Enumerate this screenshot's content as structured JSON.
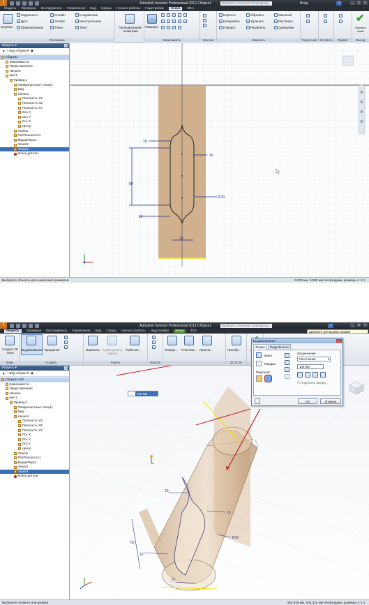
{
  "app": {
    "title": "Autodesk Inventor Professional 2012   Сборка1",
    "search_placeholder": "Введите ключевое слово/фразу",
    "login": "Вход",
    "help": "?",
    "tooltip": "Щелкните для вызова справки",
    "window_buttons": [
      "_",
      "□",
      "×"
    ]
  },
  "tabs": [
    "Модель",
    "Проверка",
    "Инструменты",
    "Управление",
    "Вид",
    "Среды",
    "Начало работы",
    "Надстройки",
    "Эскиз",
    "3DA"
  ],
  "active_tab": "Эскиз",
  "ribbon1": {
    "draw": {
      "otrezok": "Отрезок",
      "items": [
        "Окружность",
        "Дуга",
        "Прямоугольник",
        "Сплайн",
        "Эллипс",
        "Точка",
        "Сопряжение",
        "Многоугольник",
        "Текст"
      ],
      "label": "Рисование"
    },
    "project": "Проецирование геометрии",
    "dimension": "Размеры",
    "constraints_label": "Зависимость",
    "pattern_label": "Массив",
    "modify": {
      "items": [
        "Перенос",
        "Обрезать",
        "Масштаб",
        "Копировать",
        "Удлинить",
        "Растянуть",
        "Поворот",
        "Разделить",
        "Смещение"
      ],
      "label": "Изменить"
    },
    "insert_label": "Вставить",
    "format_label": "Формат",
    "layout_label": "Подсосная",
    "accept": "Принять эскиз",
    "exit_label": "Выход"
  },
  "ribbon2": {
    "sketch": "Создать 2D эскиз",
    "sketch_group": "Эскиз",
    "extrude": "Выдавливание",
    "revolve": "Вращение",
    "create_label": "Создать",
    "modify": "Изменить",
    "edit": "Редактировать модель",
    "work": "Рабочие...",
    "fusion_label": "Fusion",
    "surface": "Поверх...",
    "plastic": "Пластма...",
    "sheet": "Прокла...",
    "convert": "Преобр...",
    "to3d": "2D to 3D",
    "pattern_label": "Массив",
    "accept": "Принять эскиз"
  },
  "browser": {
    "title": "Модель",
    "view": "Вид сборки",
    "tree1": [
      {
        "label": "Сборка1",
        "level": 0,
        "state": "hl"
      },
      {
        "label": "Зависимости",
        "level": 1
      },
      {
        "label": "Представления",
        "level": 1
      },
      {
        "label": "Начало",
        "level": 1
      },
      {
        "label": "вал:1",
        "level": 1
      },
      {
        "label": "Привод:1",
        "level": 2
      },
      {
        "label": "Поверхностные тела(1)",
        "level": 3
      },
      {
        "label": "Вид:",
        "level": 3
      },
      {
        "label": "Начало",
        "level": 3
      },
      {
        "label": "Плоскость YZ",
        "level": 4
      },
      {
        "label": "Плоскость XZ",
        "level": 4
      },
      {
        "label": "Плоскость XY",
        "level": 4
      },
      {
        "label": "Ось X",
        "level": 4
      },
      {
        "label": "Ось Y",
        "level": 4
      },
      {
        "label": "Ось Z",
        "level": 4
      },
      {
        "label": "Центр",
        "level": 4
      },
      {
        "label": "Эскиз1",
        "level": 3
      },
      {
        "label": "РабПлоскость1",
        "level": 3
      },
      {
        "label": "ВыдавПерс1",
        "level": 3
      },
      {
        "label": "Эскиз2",
        "level": 3
      },
      {
        "label": "Эскиз3",
        "level": 3,
        "state": "sel"
      },
      {
        "label": "Конец детали",
        "level": 3,
        "state": "end"
      }
    ],
    "tree2": [
      {
        "label": "Сборка1.iam",
        "level": 0,
        "state": "hl"
      },
      {
        "label": "Зависимости",
        "level": 1
      },
      {
        "label": "Представления",
        "level": 1
      },
      {
        "label": "Начало",
        "level": 1
      },
      {
        "label": "вал:1",
        "level": 1
      },
      {
        "label": "Привод:1",
        "level": 2
      },
      {
        "label": "Поверхностные тела(1)",
        "level": 3
      },
      {
        "label": "Вид:",
        "level": 3
      },
      {
        "label": "Начало",
        "level": 3
      },
      {
        "label": "Плоскость YZ",
        "level": 4
      },
      {
        "label": "Плоскость XZ",
        "level": 4
      },
      {
        "label": "Плоскость XY",
        "level": 4
      },
      {
        "label": "Ось X",
        "level": 4
      },
      {
        "label": "Ось Y",
        "level": 4
      },
      {
        "label": "Ось Z",
        "level": 4
      },
      {
        "label": "Центр",
        "level": 4
      },
      {
        "label": "Эскиз1",
        "level": 3
      },
      {
        "label": "РабПлоскость1",
        "level": 3
      },
      {
        "label": "ВыдавПерс1",
        "level": 3
      },
      {
        "label": "Эскиз2",
        "level": 3
      },
      {
        "label": "Эскиз3",
        "level": 3,
        "state": "sel"
      },
      {
        "label": "Конец детали",
        "level": 3,
        "state": "end"
      }
    ]
  },
  "drawing": {
    "dims": [
      "10",
      "10",
      "50",
      "10",
      "R10",
      "10"
    ]
  },
  "dialog": {
    "title": "Выдавливание",
    "tabs": [
      "Форма",
      "Подробности"
    ],
    "profile": "Эскиз",
    "solids": "Твердые",
    "output": "Результат",
    "extents_label": "Ограничение",
    "extents_value": "Расстояние",
    "distance": "100 мм",
    "match": "Подогнать форму",
    "ok": "OK",
    "cancel": "Отмена",
    "dist_input": "100 мм"
  },
  "status1": {
    "left": "Выберите объекты для нанесения размеров",
    "right": "0,000 мм, 0,000 мм   Необходимы размеры 2   2   3"
  },
  "status2": {
    "left": "Выберите элемент или размер",
    "right": "-353,618 мм, 534,322 мм   Необходимы размеры 2   2   3"
  },
  "colors": {
    "part": "#c9a27a",
    "dim": "#1c2a8a",
    "accent": "#3c6fb3",
    "arrow": "#c02222"
  }
}
